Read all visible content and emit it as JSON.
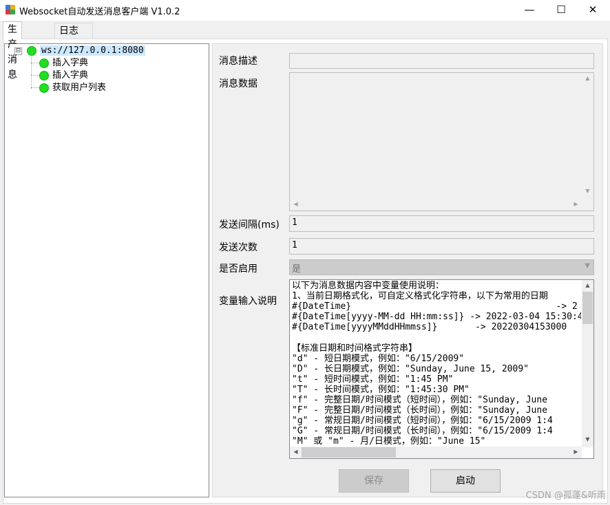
{
  "window": {
    "title": "Websocket自动发送消息客户端 V1.0.2",
    "minimize": "—",
    "maximize": "☐",
    "close": "✕"
  },
  "tabs": [
    {
      "label": "生产消息",
      "active": true
    },
    {
      "label": "日志",
      "active": false
    }
  ],
  "tree": {
    "root": "ws://127.0.0.1:8080",
    "expander": "⊟",
    "children": [
      "插入字典",
      "插入字典",
      "获取用户列表"
    ]
  },
  "form": {
    "description_label": "消息描述",
    "description_value": "",
    "data_label": "消息数据",
    "data_value": "",
    "interval_label": "发送间隔(ms)",
    "interval_value": "1",
    "count_label": "发送次数",
    "count_value": "1",
    "enabled_label": "是否启用",
    "enabled_value": "是",
    "variables_label": "变量输入说明"
  },
  "help_text": "以下为消息数据内容中变量使用说明：\n1、当前日期格式化，可自定义格式化字符串，以下为常用的日期\n#{DateTime}                                      -> 2\n#{DateTime[yyyy-MM-dd HH:mm:ss]} -> 2022-03-04 15:30:4\n#{DateTime[yyyyMMddHHmmss]}       -> 20220304153000\n\n【标准日期和时间格式字符串】\n\"d\" - 短日期模式，例如：\"6/15/2009\"\n\"D\" - 长日期模式，例如：\"Sunday, June 15, 2009\"\n\"t\" - 短时间模式，例如：\"1:45 PM\"\n\"T\" - 长时间模式，例如：\"1:45:30 PM\"\n\"f\" - 完整日期/时间模式（短时间），例如：\"Sunday, June\n\"F\" - 完整日期/时间模式（长时间），例如：\"Sunday, June\n\"g\" - 常规日期/时间模式（短时间），例如：\"6/15/2009 1:4\n\"G\" - 常规日期/时间模式（长时间），例如：\"6/15/2009 1:4\n\"M\" 或 \"m\" - 月/日模式，例如：\"June 15\"",
  "buttons": {
    "save": "保存",
    "start": "启动"
  },
  "watermark": "CSDN @孤蓬&听雨",
  "colors": {
    "status_dot": "#22dd22",
    "selected_node_bg": "#cce8ff"
  }
}
